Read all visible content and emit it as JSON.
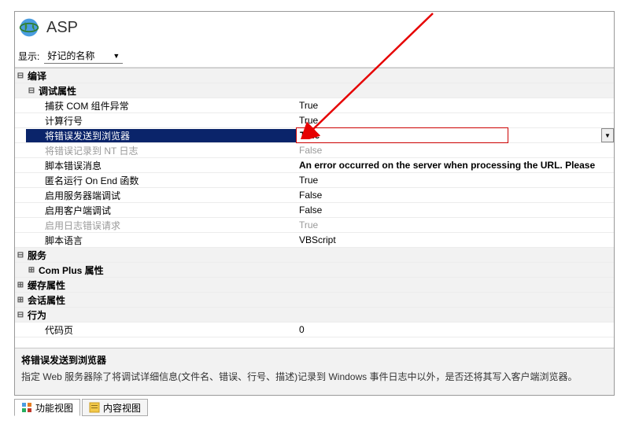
{
  "header": {
    "title": "ASP"
  },
  "display": {
    "label": "显示:",
    "selected": "好记的名称"
  },
  "categories": {
    "compile": "编译",
    "debug": "调试属性",
    "script_lang": "脚本语言",
    "services": "服务",
    "complus": "Com Plus 属性",
    "cache": "缓存属性",
    "session": "会话属性",
    "behavior": "行为",
    "codepage": "代码页"
  },
  "props": {
    "catch_com": {
      "label": "捕获 COM 组件异常",
      "value": "True"
    },
    "calc_line": {
      "label": "计算行号",
      "value": "True"
    },
    "send_errors": {
      "label": "将错误发送到浏览器",
      "value": "True"
    },
    "log_nt": {
      "label": "将错误记录到 NT 日志",
      "value": "False"
    },
    "script_err_msg": {
      "label": "脚本错误消息",
      "value": "An error occurred on the server when processing the URL. Please"
    },
    "anon_onend": {
      "label": "匿名运行 On End 函数",
      "value": "True"
    },
    "server_debug": {
      "label": "启用服务器端调试",
      "value": "False"
    },
    "client_debug": {
      "label": "启用客户端调试",
      "value": "False"
    },
    "log_err_req": {
      "label": "启用日志错误请求",
      "value": "True"
    },
    "script_lang_val": {
      "value": "VBScript"
    },
    "codepage_val": {
      "value": "0"
    }
  },
  "description": {
    "title": "将错误发送到浏览器",
    "text": "指定 Web 服务器除了将调试详细信息(文件名、错误、行号、描述)记录到 Windows 事件日志中以外，是否还将其写入客户端浏览器。"
  },
  "tabs": {
    "features": "功能视图",
    "content": "内容视图"
  }
}
